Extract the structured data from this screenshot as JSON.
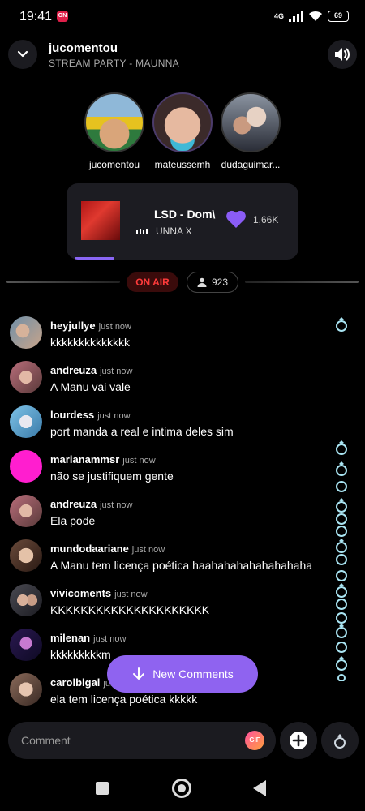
{
  "status_bar": {
    "time": "19:41",
    "app_badge": "ON",
    "network": "4G",
    "battery": "69"
  },
  "header": {
    "host": "jucomentou",
    "party": "STREAM PARTY - MAUNNA"
  },
  "participants": [
    {
      "name": "jucomentou"
    },
    {
      "name": "mateussemh"
    },
    {
      "name": "dudaguimar..."
    }
  ],
  "player": {
    "title": "LSD - Dom\\",
    "artist": "UNNA X",
    "likes": "1,66K",
    "progress": 0.17
  },
  "live": {
    "on_air": "ON AIR",
    "viewers": "923"
  },
  "chat": [
    {
      "user": "heyjullye",
      "time": "just now",
      "text": "kkkkkkkkkkkkkk"
    },
    {
      "user": "andreuza",
      "time": "just now",
      "text": "A Manu vai vale"
    },
    {
      "user": "lourdess",
      "time": "just now",
      "text": "port manda a real e intima deles sim"
    },
    {
      "user": "marianammsr",
      "time": "just now",
      "text": "não se justifiquem gente"
    },
    {
      "user": "andreuza",
      "time": "just now",
      "text": "Ela pode"
    },
    {
      "user": "mundodaariane",
      "time": "just now",
      "text": "A Manu tem licença poética haahahahahahahahaha"
    },
    {
      "user": "vivicoments",
      "time": "just now",
      "text": "KKKKKKKKKKKKKKKKKKKKK"
    },
    {
      "user": "milenan",
      "time": "just now",
      "text": "kkkkkkkkkm"
    },
    {
      "user": "carolbigal",
      "time": "just now",
      "text": "ela tem licença poética kkkkk"
    }
  ],
  "new_comments_label": "New Comments",
  "comment_box": {
    "placeholder": "Comment",
    "gif_label": "GIF"
  },
  "colors": {
    "accent": "#8f63f0",
    "heart": "#8a5cf6",
    "on_air": "#ff3b3b",
    "ring": "#a9e4f2"
  }
}
